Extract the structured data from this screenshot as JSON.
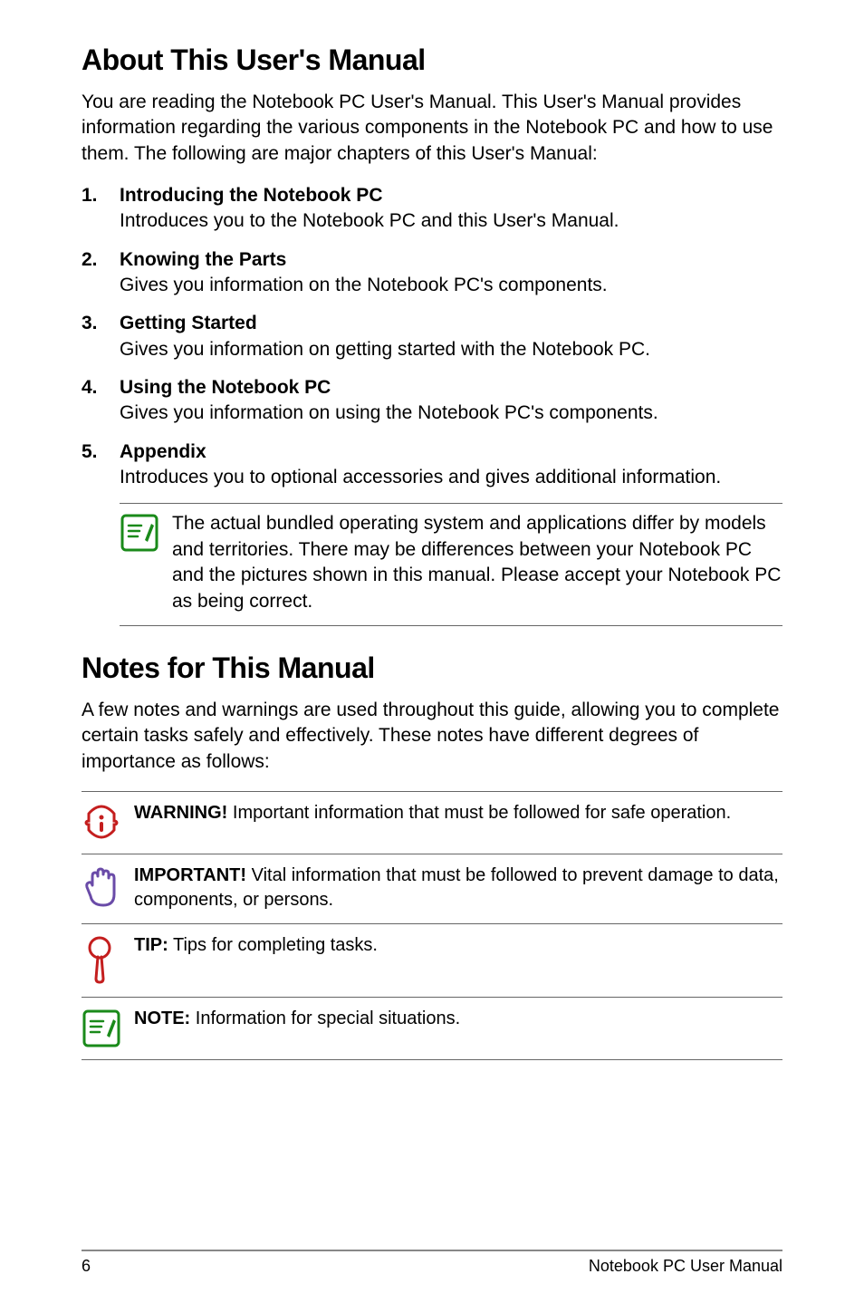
{
  "section1": {
    "heading": "About This User's Manual",
    "intro": "You are reading the Notebook PC User's Manual. This User's Manual provides information regarding the various components in the Notebook PC and how to use them. The following are major chapters of this User's Manual:",
    "items": [
      {
        "num": "1.",
        "title": "Introducing the Notebook PC",
        "desc": "Introduces you to the Notebook PC and this User's Manual."
      },
      {
        "num": "2.",
        "title": "Knowing the Parts",
        "desc": "Gives you information on the Notebook PC's components."
      },
      {
        "num": "3.",
        "title": "Getting Started",
        "desc": "Gives you information on getting started with the Notebook PC."
      },
      {
        "num": "4.",
        "title": "Using the Notebook PC",
        "desc": "Gives you information on using the Notebook PC's components."
      },
      {
        "num": "5.",
        "title": "Appendix",
        "desc": "Introduces you to optional accessories and gives additional information."
      }
    ],
    "note": "The actual bundled operating system and applications differ by models and territories. There may be differences between your Notebook PC and the pictures shown in this manual. Please accept your Notebook PC as being correct."
  },
  "section2": {
    "heading": "Notes for This Manual",
    "intro": "A few notes and warnings are used throughout this guide, allowing you to complete certain tasks safely and effectively. These notes have different degrees of importance as follows:",
    "rows": [
      {
        "label": "WARNING!",
        "text": " Important information that must be followed for safe operation."
      },
      {
        "label": "IMPORTANT!",
        "text": " Vital information that must be followed to prevent damage to data, components, or persons."
      },
      {
        "label": "TIP:",
        "text": " Tips for completing tasks."
      },
      {
        "label": "NOTE:",
        "text": "  Information for special situations."
      }
    ]
  },
  "footer": {
    "page": "6",
    "text": "Notebook PC User Manual"
  }
}
